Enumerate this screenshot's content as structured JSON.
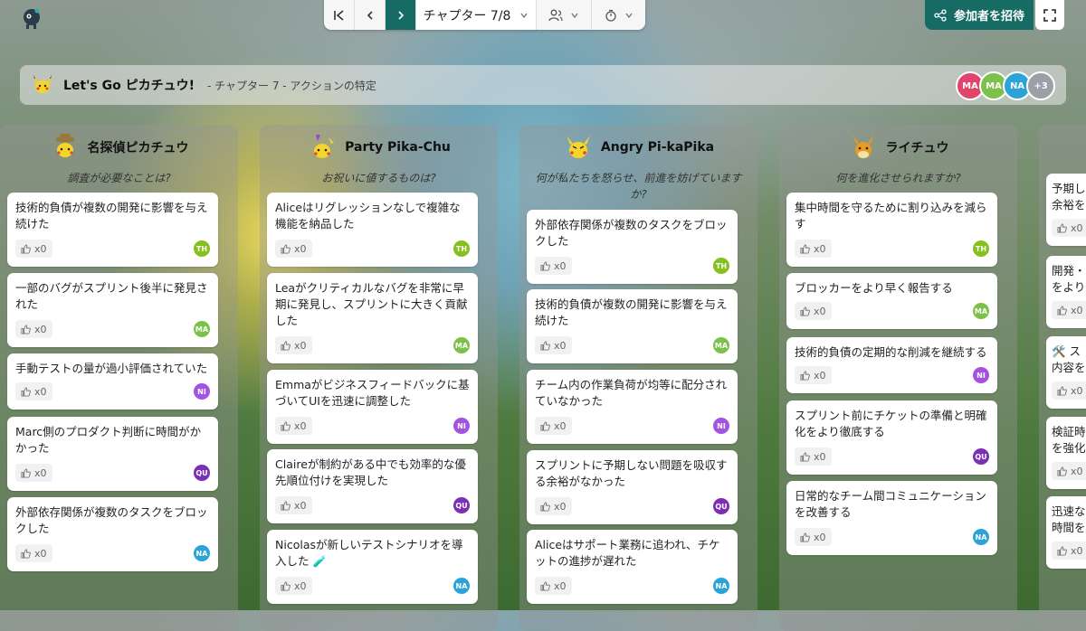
{
  "toolbar": {
    "chapter_label": "チャプター 7/8"
  },
  "invite": {
    "label": "参加者を招待"
  },
  "header": {
    "title": "Let's Go ピカチュウ!",
    "subtitle": "- チャプター 7 - アクションの特定",
    "avatars": [
      {
        "initials": "MA",
        "color": "#e0446b"
      },
      {
        "initials": "MA",
        "color": "#7cc24a"
      },
      {
        "initials": "NA",
        "color": "#2ba3d8"
      },
      {
        "initials": "+3",
        "color": "#9aa0a6"
      }
    ]
  },
  "columns": [
    {
      "title": "名探偵ピカチュウ",
      "question": "調査が必要なことは?",
      "cards": [
        {
          "text": "技術的負債が複数の開発に影響を与え続けた",
          "likes": "x0",
          "tag": "TH"
        },
        {
          "text": "一部のバグがスプリント後半に発見された",
          "likes": "x0",
          "tag": "MA"
        },
        {
          "text": "手動テストの量が過小評価されていた",
          "likes": "x0",
          "tag": "NI"
        },
        {
          "text": "Marc側のプロダクト判断に時間がかかった",
          "likes": "x0",
          "tag": "QU"
        },
        {
          "text": "外部依存関係が複数のタスクをブロックした",
          "likes": "x0",
          "tag": "NA"
        }
      ]
    },
    {
      "title": "Party Pika-Chu",
      "question": "お祝いに値するものは?",
      "cards": [
        {
          "text": "Aliceはリグレッションなしで複雑な機能を納品した",
          "likes": "x0",
          "tag": "TH"
        },
        {
          "text": "Leaがクリティカルなバグを非常に早期に発見し、スプリントに大きく貢献した",
          "likes": "x0",
          "tag": "MA"
        },
        {
          "text": "Emmaがビジネスフィードバックに基づいてUIを迅速に調整した",
          "likes": "x0",
          "tag": "NI"
        },
        {
          "text": "Claireが制約がある中でも効率的な優先順位付けを実現した",
          "likes": "x0",
          "tag": "QU"
        },
        {
          "text": "Nicolasが新しいテストシナリオを導入した 🧪",
          "likes": "x0",
          "tag": "NA"
        }
      ]
    },
    {
      "title": "Angry Pi-kaPika",
      "question": "何が私たちを怒らせ、前進を妨げていますか?",
      "cards": [
        {
          "text": "外部依存関係が複数のタスクをブロックした",
          "likes": "x0",
          "tag": "TH"
        },
        {
          "text": "技術的負債が複数の開発に影響を与え続けた",
          "likes": "x0",
          "tag": "MA"
        },
        {
          "text": "チーム内の作業負荷が均等に配分されていなかった",
          "likes": "x0",
          "tag": "NI"
        },
        {
          "text": "スプリントに予期しない問題を吸収する余裕がなかった",
          "likes": "x0",
          "tag": "QU"
        },
        {
          "text": "Aliceはサポート業務に追われ、チケットの進捗が遅れた",
          "likes": "x0",
          "tag": "NA"
        }
      ]
    },
    {
      "title": "ライチュウ",
      "question": "何を進化させられますか?",
      "cards": [
        {
          "text": "集中時間を守るために割り込みを減らす",
          "likes": "x0",
          "tag": "TH"
        },
        {
          "text": "ブロッカーをより早く報告する",
          "likes": "x0",
          "tag": "MA"
        },
        {
          "text": "技術的負債の定期的な削減を継続する",
          "likes": "x0",
          "tag": "NI"
        },
        {
          "text": "スプリント前にチケットの準備と明確化をより徹底する",
          "likes": "x0",
          "tag": "QU"
        },
        {
          "text": "日常的なチーム間コミュニケーションを改善する",
          "likes": "x0",
          "tag": "NA"
        }
      ]
    }
  ],
  "partial_column": {
    "cards": [
      {
        "text": "予期し\n余裕を",
        "likes": "x0"
      },
      {
        "text": "開発・\nをより",
        "likes": "x0"
      },
      {
        "text": "🛠️ ス\n内容を",
        "likes": "x0"
      },
      {
        "text": "検証時\nを強化",
        "likes": "x0"
      },
      {
        "text": "迅速な\n時間を",
        "likes": "x0"
      }
    ]
  }
}
